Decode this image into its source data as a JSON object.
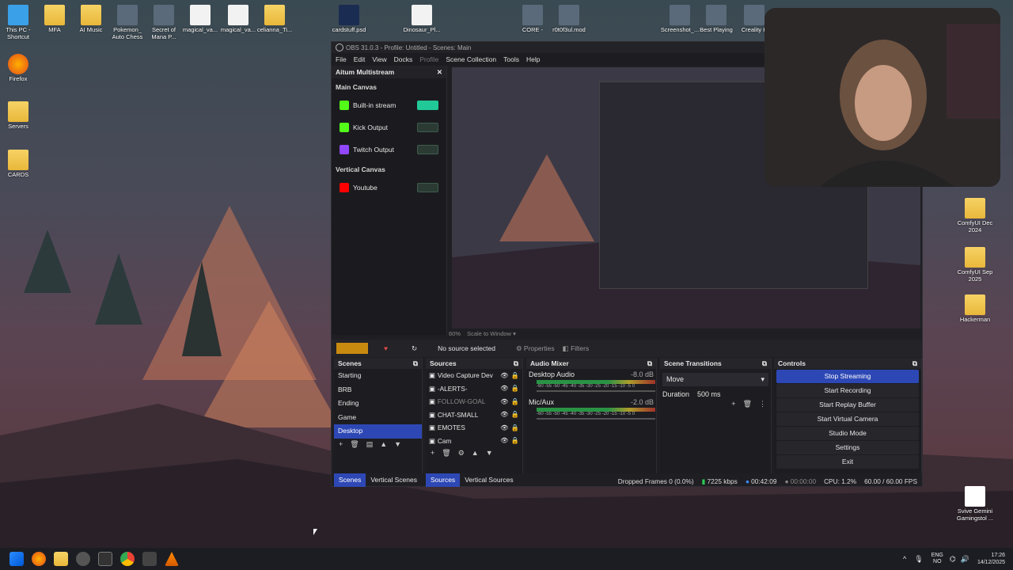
{
  "desktop_icons_top": [
    {
      "label": "This PC -\nShortcut",
      "kind": "pc"
    },
    {
      "label": "MFA",
      "kind": "folder"
    },
    {
      "label": "AI Music",
      "kind": "folder"
    },
    {
      "label": "Pokemon_\nAuto Chess",
      "kind": "app"
    },
    {
      "label": "Secret of\nMana P...",
      "kind": "app"
    },
    {
      "label": "magical_va...",
      "kind": "doc"
    },
    {
      "label": "magical_va...",
      "kind": "doc"
    },
    {
      "label": "celianna_Ti...",
      "kind": "folder"
    },
    {
      "label": "cardstuff.psd",
      "kind": "psd"
    },
    {
      "label": "Dinosaur_Pl...",
      "kind": "doc"
    },
    {
      "label": "CORE -",
      "kind": "app"
    },
    {
      "label": "r0t0f3ul.mod",
      "kind": "app"
    },
    {
      "label": "Screenshot_...",
      "kind": "app"
    },
    {
      "label": "Best Playing",
      "kind": "app"
    },
    {
      "label": "Creality K",
      "kind": "app"
    }
  ],
  "desktop_icons_left": [
    "Firefox",
    "Servers",
    "CARDS"
  ],
  "desktop_icons_right": [
    "ComfyUI Dec\n2024",
    "ComfyUI Sep\n2025",
    "Hackerman",
    "Svive Gemini\nGamingstol ..."
  ],
  "obs": {
    "title": "OBS 31.0.3 - Profile: Untitled - Scenes: Main",
    "menu": [
      "File",
      "Edit",
      "View",
      "Docks",
      "Profile",
      "Scene Collection",
      "Tools",
      "Help"
    ],
    "dock_title": "Aitum Multistream",
    "main_canvas": "Main Canvas",
    "outputs": [
      {
        "name": "Built-in stream",
        "on": true,
        "color": "#53fc18"
      },
      {
        "name": "Kick Output",
        "on": false,
        "color": "#53fc18"
      },
      {
        "name": "Twitch Output",
        "on": false,
        "color": "#9146ff"
      }
    ],
    "vertical_canvas": "Vertical Canvas",
    "vertical_outputs": [
      {
        "name": "Youtube",
        "on": false,
        "color": "#ff0000"
      }
    ],
    "zoom": "60%",
    "scale_mode": "Scale to Window",
    "no_source": "No source selected",
    "properties": "Properties",
    "filters": "Filters",
    "scenes_title": "Scenes",
    "scenes": [
      "Starting",
      "BRB",
      "Ending",
      "Game",
      "Desktop"
    ],
    "selected_scene": "Desktop",
    "sources_title": "Sources",
    "sources": [
      {
        "name": "Video Capture Dev",
        "dim": false
      },
      {
        "name": "-ALERTS-",
        "dim": false
      },
      {
        "name": "FOLLOW-GOAL",
        "dim": true
      },
      {
        "name": "CHAT-SMALL",
        "dim": false
      },
      {
        "name": "EMOTES",
        "dim": false
      },
      {
        "name": "Cam",
        "dim": false
      }
    ],
    "mixer_title": "Audio Mixer",
    "channels": [
      {
        "name": "Desktop Audio",
        "db": "-8.0 dB"
      },
      {
        "name": "Mic/Aux",
        "db": "-2.0 dB"
      }
    ],
    "scale_labels": "-60 -55 -50 -45 -40 -35 -30 -25 -20 -15 -10 -5 0",
    "transitions_title": "Scene Transitions",
    "transition": "Move",
    "duration_label": "Duration",
    "duration": "500 ms",
    "controls_title": "Controls",
    "controls": [
      "Stop Streaming",
      "Start Recording",
      "Start Replay Buffer",
      "Start Virtual Camera",
      "Studio Mode",
      "Settings",
      "Exit"
    ],
    "tabs_left": [
      "Scenes",
      "Vertical Scenes"
    ],
    "tabs_mid": [
      "Sources",
      "Vertical Sources"
    ],
    "status": {
      "dropped": "Dropped Frames 0 (0.0%)",
      "kbps": "7225 kbps",
      "live": "00:42:09",
      "rec": "00:00:00",
      "cpu": "CPU: 1.2%",
      "fps": "60.00 / 60.00 FPS"
    }
  },
  "tray": {
    "lang1": "ENG",
    "lang2": "NO",
    "time": "17:26",
    "date": "14/12/2025"
  }
}
